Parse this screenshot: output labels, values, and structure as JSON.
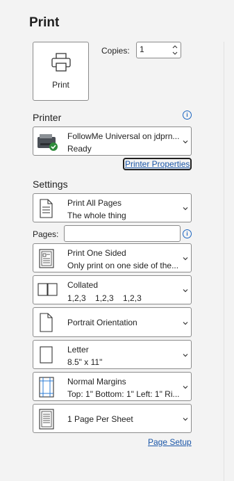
{
  "header": {
    "title": "Print"
  },
  "print_button": {
    "label": "Print"
  },
  "copies": {
    "label": "Copies:",
    "value": "1"
  },
  "printer": {
    "section_label": "Printer",
    "info_icon": "i",
    "name": "FollowMe Universal on jdprn...",
    "status": "Ready",
    "properties_link": "Printer Properties"
  },
  "settings": {
    "section_label": "Settings",
    "pages_label": "Pages:",
    "pages_value": "",
    "pages_info_icon": "i",
    "items": [
      {
        "line1": "Print All Pages",
        "line2": "The whole thing",
        "icon": "document-icon"
      },
      {
        "line1": "Print One Sided",
        "line2": "Only print on one side of the...",
        "icon": "one-sided-icon"
      },
      {
        "line1": "Collated",
        "line2": "1,2,3    1,2,3    1,2,3",
        "icon": "collated-icon"
      },
      {
        "line1": "Portrait Orientation",
        "line2": "",
        "icon": "portrait-icon"
      },
      {
        "line1": "Letter",
        "line2": "8.5\" x 11\"",
        "icon": "paper-size-icon"
      },
      {
        "line1": "Normal Margins",
        "line2": "Top: 1\" Bottom: 1\" Left: 1\" Ri...",
        "icon": "margins-icon"
      },
      {
        "line1": "1 Page Per Sheet",
        "line2": "",
        "icon": "pages-per-sheet-icon"
      }
    ],
    "page_setup_link": "Page Setup"
  },
  "colors": {
    "link": "#1a56a8",
    "info": "#1a64c0",
    "status_ok": "#2e8b3a"
  }
}
